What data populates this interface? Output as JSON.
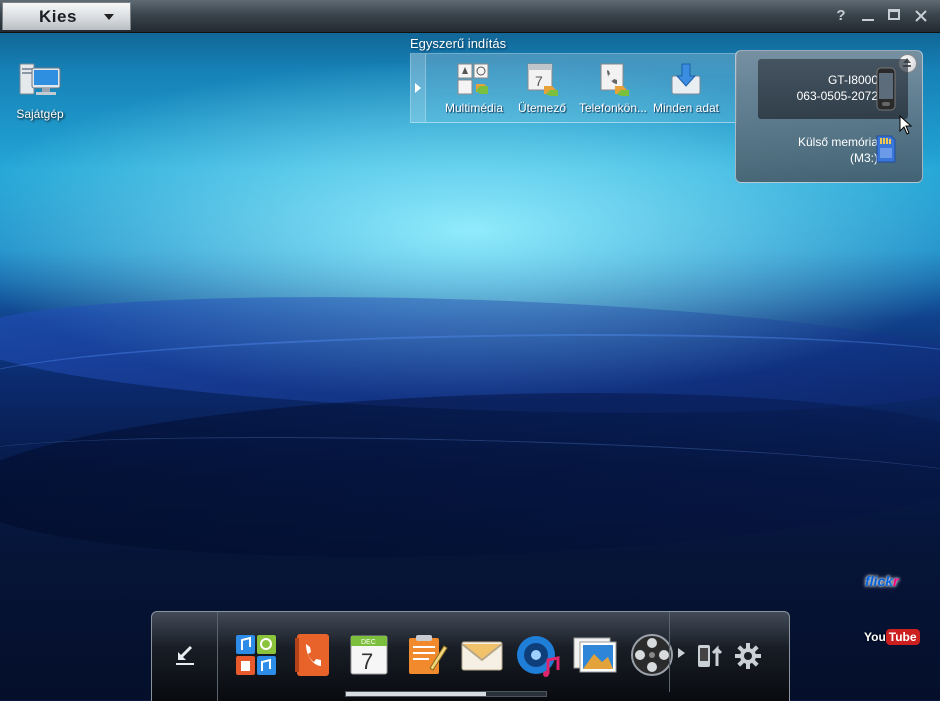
{
  "window": {
    "app_name": "Kies",
    "buttons": {
      "help": "?"
    }
  },
  "desktop": {
    "icons": [
      {
        "label": "Sajátgép",
        "icon": "my-computer-icon"
      }
    ]
  },
  "quick_launch": {
    "title": "Egyszerű indítás",
    "items": [
      {
        "label": "Multimédia",
        "icon": "multimedia-icon"
      },
      {
        "label": "Ütemező",
        "icon": "scheduler-icon"
      },
      {
        "label": "Telefonkön...",
        "icon": "phonebook-icon"
      },
      {
        "label": "Minden adat",
        "icon": "all-data-icon"
      }
    ]
  },
  "device_panel": {
    "device": {
      "name": "GT-I8000",
      "serial": "063-0505-2072",
      "icon": "phone-icon"
    },
    "memory": {
      "name": "Külső memória",
      "drive": "(M3:)",
      "icon": "sd-card-icon"
    }
  },
  "web_services": {
    "flickr": {
      "part1": "flick",
      "part2": "r"
    },
    "youtube": {
      "part1": "You",
      "part2": "Tube"
    }
  },
  "dock": {
    "apps": [
      {
        "name": "multimedia-app-icon"
      },
      {
        "name": "phonebook-app-icon"
      },
      {
        "name": "calendar-app-icon",
        "month": "DEC",
        "day": "7"
      },
      {
        "name": "memo-app-icon"
      },
      {
        "name": "message-app-icon"
      },
      {
        "name": "music-app-icon"
      },
      {
        "name": "photo-app-icon"
      },
      {
        "name": "video-app-icon"
      }
    ],
    "tools": [
      {
        "name": "phone-upload-icon"
      },
      {
        "name": "settings-gear-icon"
      }
    ]
  },
  "colors": {
    "accent_blue": "#23a6d6",
    "titlebar": "#3b454d",
    "dock": "#191e26"
  }
}
